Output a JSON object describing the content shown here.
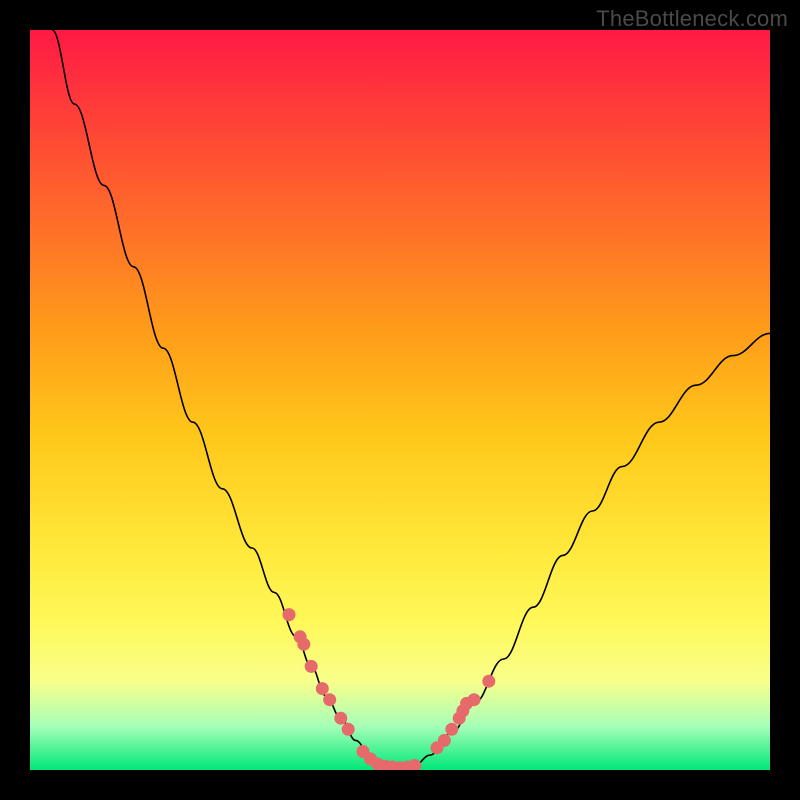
{
  "watermark": "TheBottleneck.com",
  "chart_data": {
    "type": "line",
    "title": "",
    "xlabel": "",
    "ylabel": "",
    "xlim": [
      0,
      100
    ],
    "ylim": [
      0,
      100
    ],
    "grid": false,
    "legend": false,
    "series": [
      {
        "name": "bottleneck-curve",
        "x": [
          3,
          6,
          10,
          14,
          18,
          22,
          26,
          30,
          33,
          36,
          38,
          40,
          42,
          44,
          46,
          48,
          50,
          52,
          54,
          57,
          60,
          64,
          68,
          72,
          76,
          80,
          85,
          90,
          95,
          100
        ],
        "y": [
          100,
          90,
          79,
          68,
          57,
          47,
          38,
          30,
          24,
          18,
          14,
          10,
          7,
          4,
          2,
          0.8,
          0.3,
          0.6,
          2,
          5,
          9,
          15,
          22,
          29,
          35,
          41,
          47,
          52,
          56,
          59
        ]
      }
    ],
    "highlight_points": {
      "name": "bottleneck-zone-points",
      "x": [
        35,
        36.5,
        37,
        38,
        39.5,
        40.5,
        42,
        43,
        45,
        46,
        47,
        48,
        49,
        50,
        51,
        52,
        55,
        56,
        57,
        58,
        58.5,
        59,
        60,
        62
      ],
      "y": [
        21,
        18,
        17,
        14,
        11,
        9.5,
        7,
        5.5,
        2.5,
        1.5,
        0.8,
        0.5,
        0.4,
        0.3,
        0.4,
        0.6,
        3,
        4,
        5.5,
        7,
        8,
        9,
        9.5,
        12
      ]
    }
  }
}
